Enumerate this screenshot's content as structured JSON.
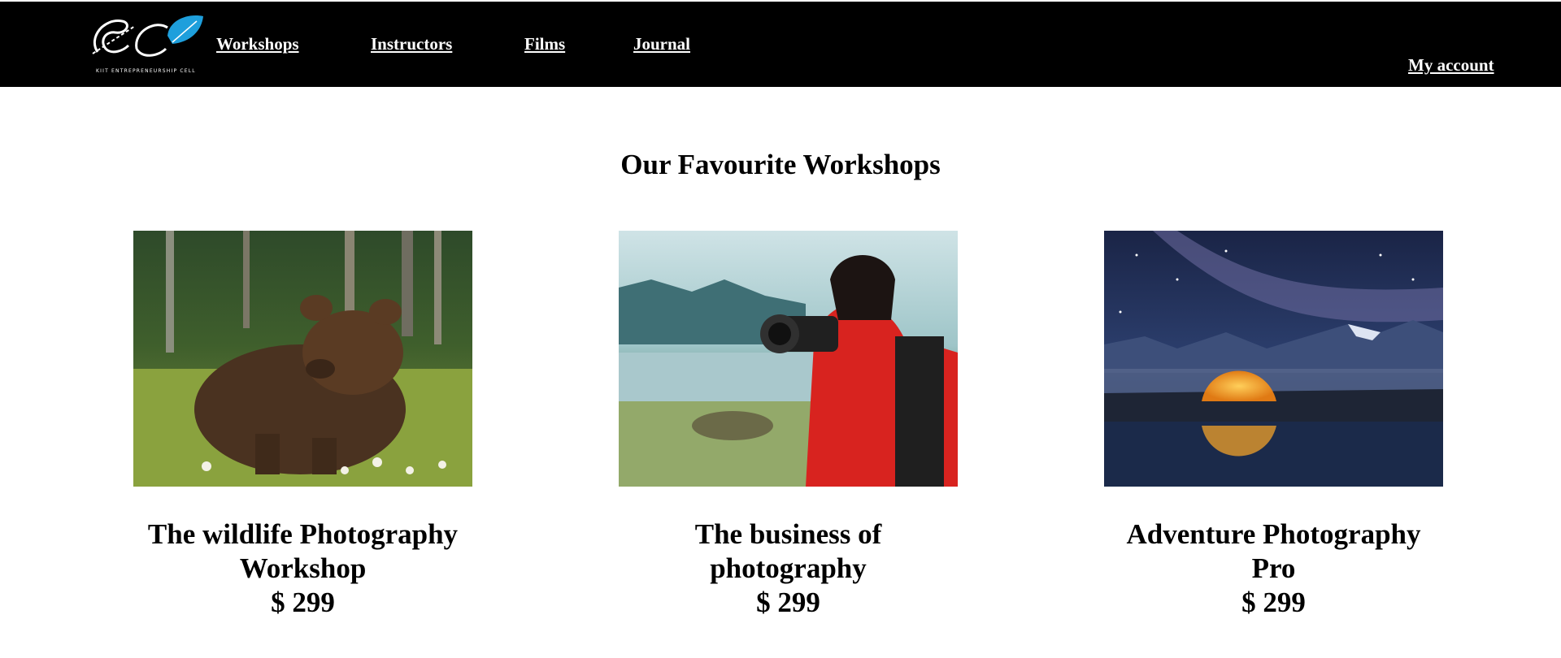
{
  "header": {
    "logo_tagline": "KIIT ENTREPRENEURSHIP CELL",
    "nav": [
      {
        "label": "Workshops"
      },
      {
        "label": "Instructors"
      },
      {
        "label": "Films"
      },
      {
        "label": "Journal"
      }
    ],
    "account_label": "My account"
  },
  "main": {
    "title": "Our Favourite Workshops",
    "workshops": [
      {
        "title_line1": "The wildlife Photography",
        "title_line2": "Workshop",
        "price": "$ 299"
      },
      {
        "title_line1": "The business of",
        "title_line2": "photography",
        "price": "$ 299"
      },
      {
        "title_line1": "Adventure Photography",
        "title_line2": "Pro",
        "price": "$ 299"
      }
    ]
  },
  "colors": {
    "header_bg": "#000000",
    "header_text": "#ffffff",
    "logo_accent": "#1e9fdc"
  }
}
